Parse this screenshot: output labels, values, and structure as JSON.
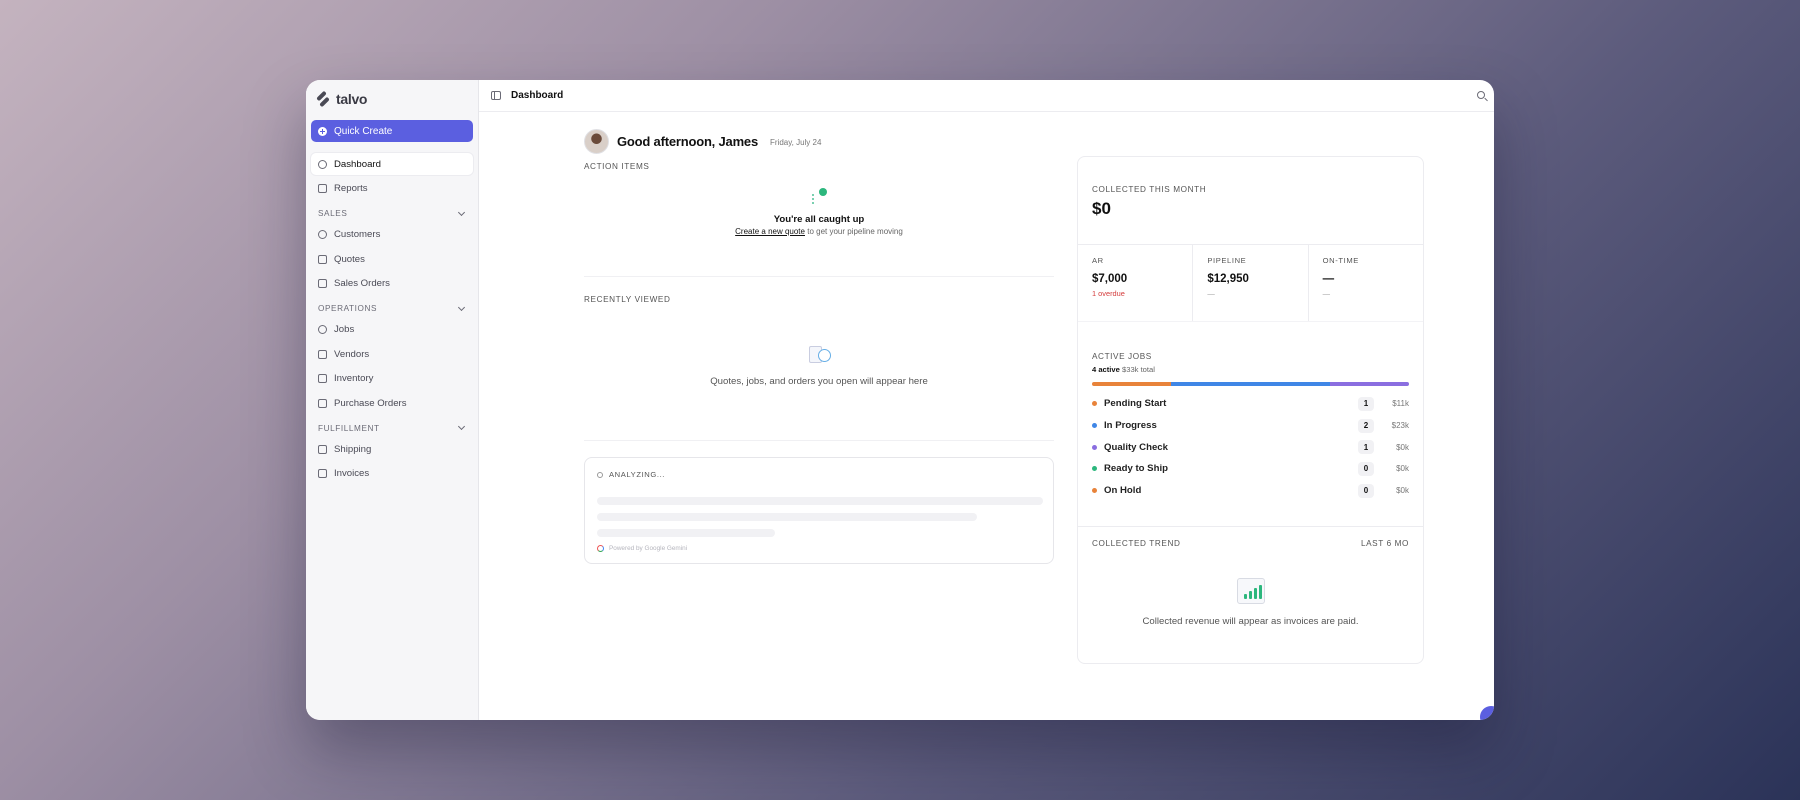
{
  "app": {
    "name": "talvo"
  },
  "sidebar": {
    "quick_create": "Quick Create",
    "top_items": [
      {
        "label": "Dashboard",
        "icon": "dashboard-icon"
      },
      {
        "label": "Reports",
        "icon": "bar-chart-icon"
      }
    ],
    "sections": [
      {
        "title": "SALES",
        "items": [
          "Customers",
          "Quotes",
          "Sales Orders"
        ]
      },
      {
        "title": "OPERATIONS",
        "items": [
          "Jobs",
          "Vendors",
          "Inventory",
          "Purchase Orders"
        ]
      },
      {
        "title": "FULFILLMENT",
        "items": [
          "Shipping",
          "Invoices"
        ]
      }
    ]
  },
  "topbar": {
    "title": "Dashboard"
  },
  "greeting": {
    "text": "Good afternoon, James",
    "date": "Friday, July 24"
  },
  "action_items": {
    "label": "ACTION ITEMS",
    "title": "You're all caught up",
    "link": "Create a new quote",
    "sub": "to get your pipeline moving"
  },
  "recently_viewed": {
    "label": "RECENTLY VIEWED",
    "empty": "Quotes, jobs, and orders you open will appear here"
  },
  "analyze": {
    "label": "ANALYZING...",
    "powered": "Powered by Google Gemini"
  },
  "collected": {
    "label": "COLLECTED THIS MONTH",
    "amount": "$0"
  },
  "kpis": [
    {
      "label": "AR",
      "value": "$7,000",
      "sub": "1 overdue",
      "sub_color": "red"
    },
    {
      "label": "PIPELINE",
      "value": "$12,950",
      "sub": "—",
      "sub_color": "gray"
    },
    {
      "label": "ON-TIME",
      "value": "—",
      "sub": "—",
      "sub_color": "gray"
    }
  ],
  "active_jobs": {
    "label": "ACTIVE JOBS",
    "active": "4 active",
    "total": "$33k total",
    "progress": [
      {
        "color": "#e8833a",
        "fraction": 0.25
      },
      {
        "color": "#3f86e6",
        "fraction": 0.5
      },
      {
        "color": "#8a6ee0",
        "fraction": 0.25
      }
    ],
    "rows": [
      {
        "name": "Pending Start",
        "count": "1",
        "amount": "$11k",
        "color": "#e8833a"
      },
      {
        "name": "In Progress",
        "count": "2",
        "amount": "$23k",
        "color": "#3f86e6"
      },
      {
        "name": "Quality Check",
        "count": "1",
        "amount": "$0k",
        "color": "#8a6ee0"
      },
      {
        "name": "Ready to Ship",
        "count": "0",
        "amount": "$0k",
        "color": "#2cb77d"
      },
      {
        "name": "On Hold",
        "count": "0",
        "amount": "$0k",
        "color": "#e8833a"
      }
    ]
  },
  "trend": {
    "label": "COLLECTED TREND",
    "range": "LAST 6 MO",
    "empty": "Collected revenue will appear as invoices are paid."
  }
}
